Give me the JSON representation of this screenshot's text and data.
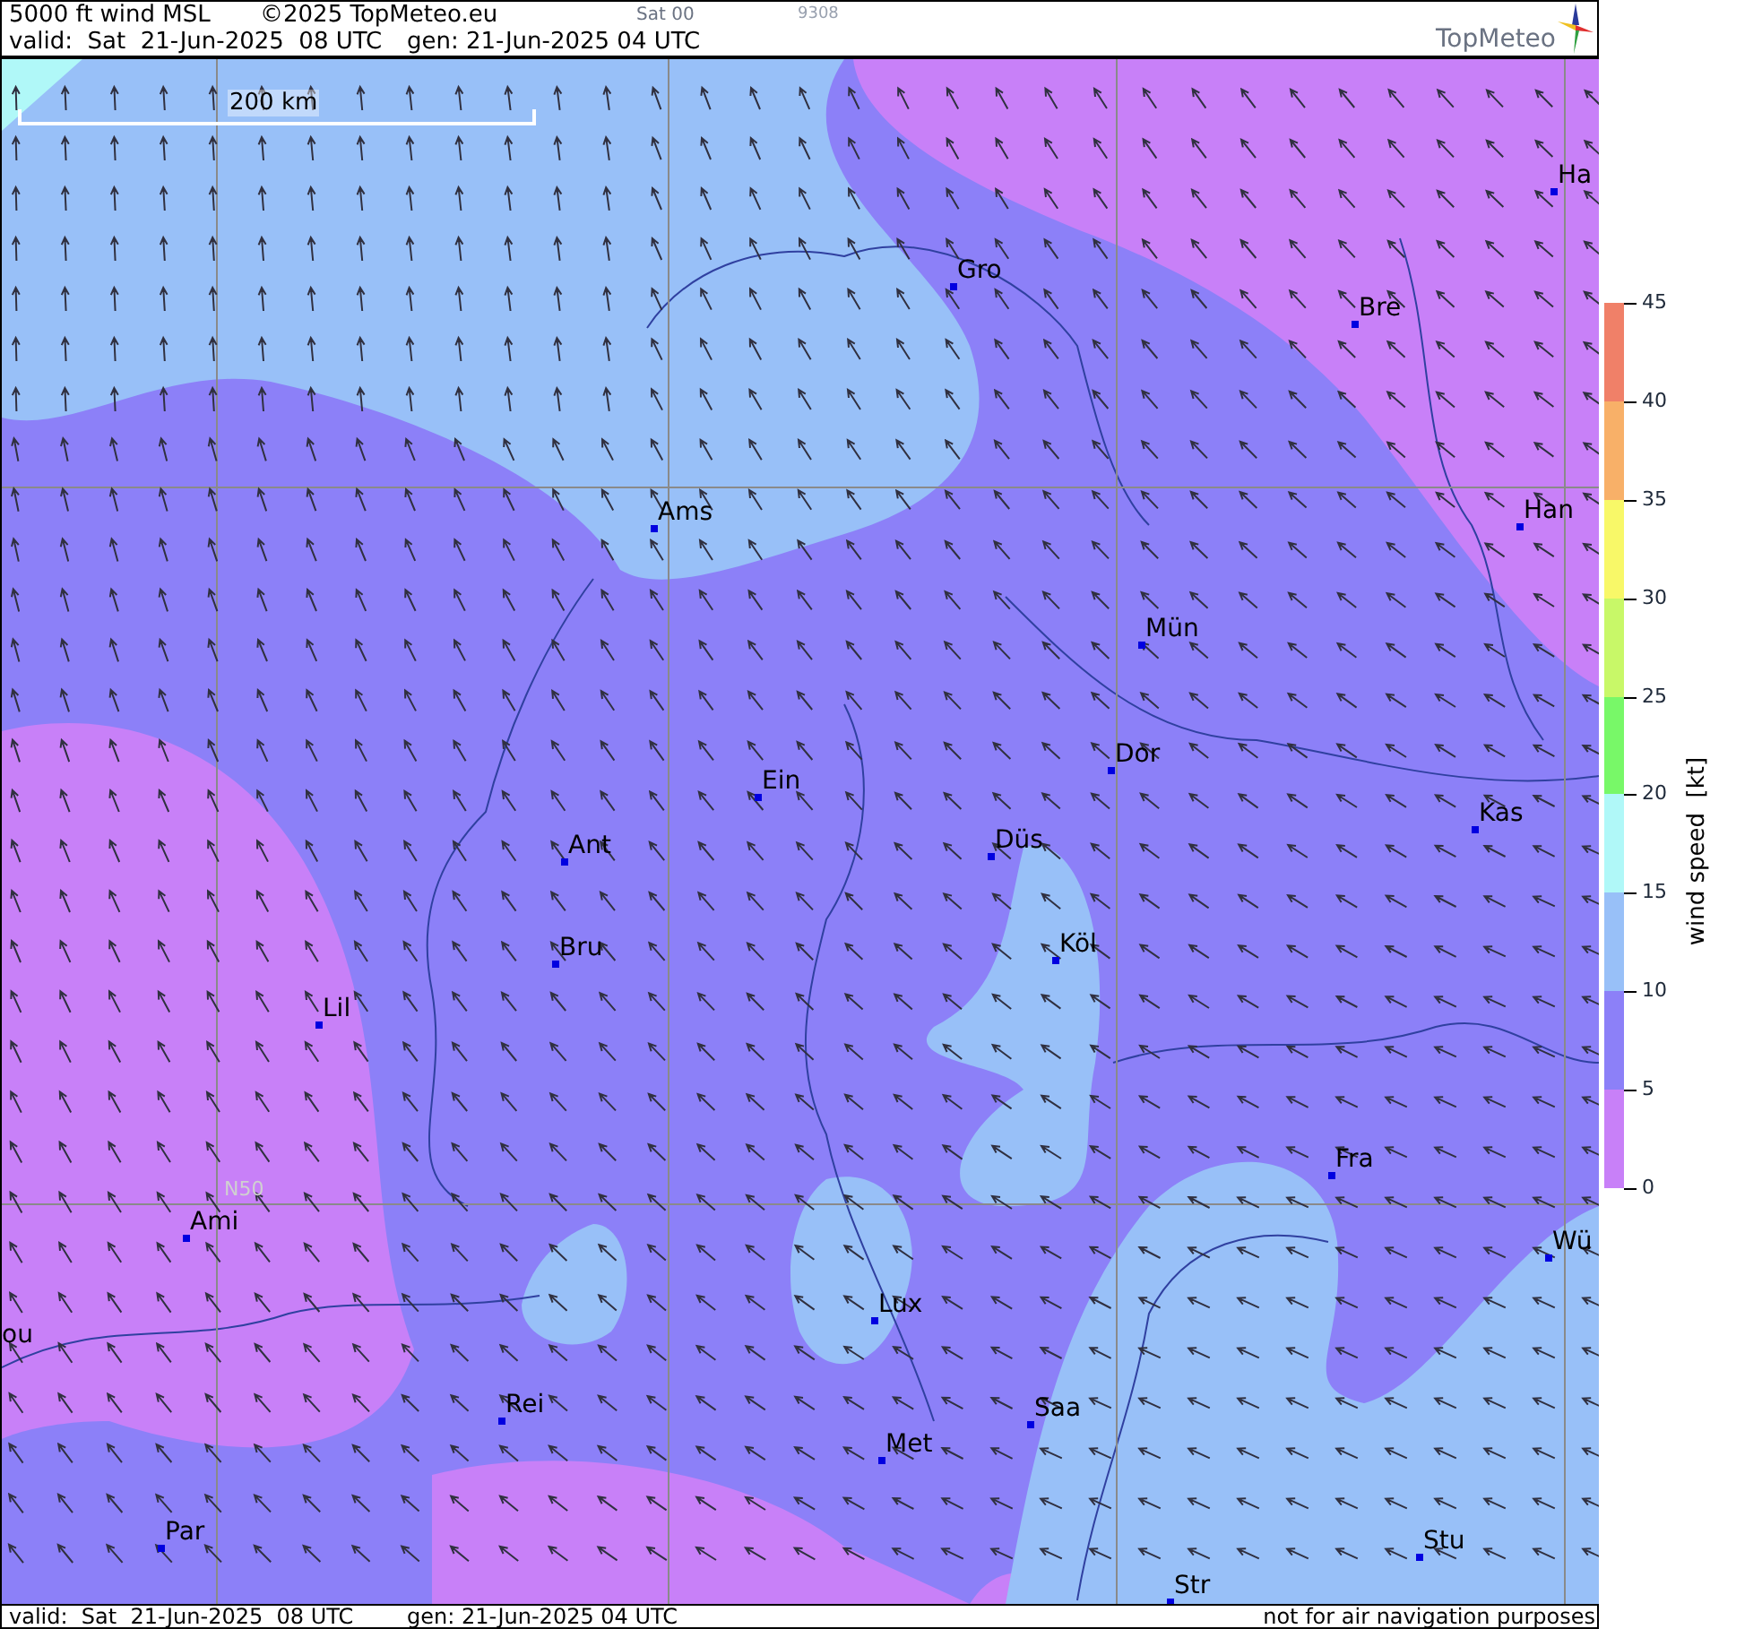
{
  "header": {
    "title": "5000 ft wind MSL",
    "copyright": "©2025 TopMeteo.eu",
    "run": "Sat 00",
    "code": "9308",
    "valid": "valid:  Sat  21-Jun-2025  08 UTC",
    "generated": "gen: 21-Jun-2025 04 UTC",
    "logo": "TopMeteo"
  },
  "map": {
    "scale": "200 km",
    "grid_label": "N50",
    "cities": [
      "Ha",
      "Gro",
      "Bre",
      "Ams",
      "Han",
      "Mün",
      "Ein",
      "Dor",
      "Kas",
      "Düs",
      "Ant",
      "Köl",
      "Bru",
      "Lil",
      "Fra",
      "Ami",
      "Wü",
      "ou",
      "Lux",
      "Rei",
      "Saa",
      "Met",
      "Par",
      "Stu",
      "Str"
    ]
  },
  "legend": {
    "title": "wind speed  [kt]",
    "ticks": [
      "45",
      "40",
      "35",
      "30",
      "25",
      "20",
      "15",
      "10",
      "5",
      "0"
    ],
    "bands": [
      {
        "color": "#f08068"
      },
      {
        "color": "#f8b068"
      },
      {
        "color": "#f8f868"
      },
      {
        "color": "#c8f868"
      },
      {
        "color": "#78f868"
      },
      {
        "color": "#b0f8f8"
      },
      {
        "color": "#98c0f8"
      },
      {
        "color": "#8c80f8"
      },
      {
        "color": "#c880f8"
      }
    ]
  },
  "footer": {
    "valid": "valid:  Sat  21-Jun-2025  08 UTC",
    "generated": "gen: 21-Jun-2025 04 UTC",
    "note": "not for air navigation purposes"
  }
}
